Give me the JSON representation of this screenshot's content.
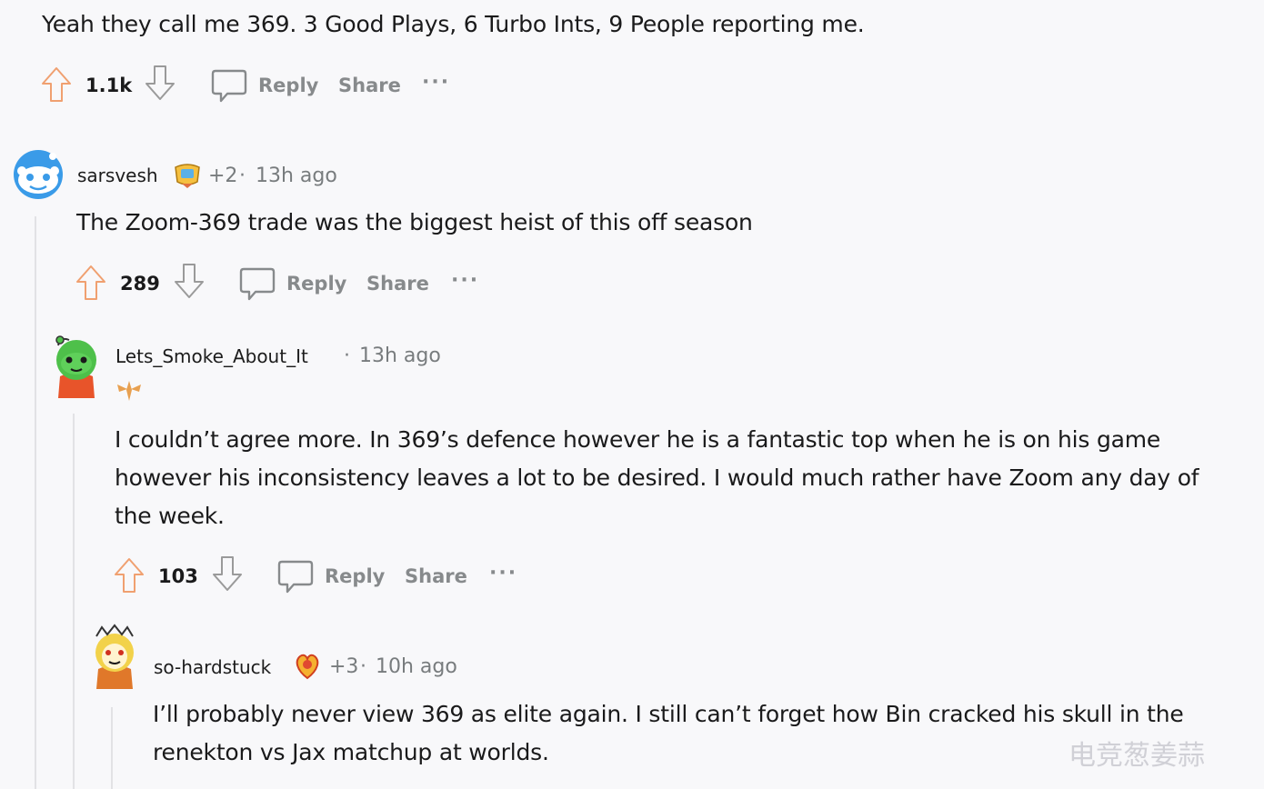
{
  "top_comment": {
    "text": "Yeah they call me 369. 3 Good Plays, 6 Turbo Ints, 9 People reporting me.",
    "votes": "1.1k",
    "reply_label": "Reply",
    "share_label": "Share",
    "more_label": "···"
  },
  "comment1": {
    "username": "sarsvesh",
    "award_count": "+2",
    "sep": "·",
    "time": "13h ago",
    "text": "The Zoom-369 trade was the biggest heist of this off season",
    "votes": "289",
    "reply_label": "Reply",
    "share_label": "Share",
    "more_label": "···"
  },
  "comment2": {
    "username": "Lets_Smoke_About_It",
    "sep": "·",
    "time": "13h ago",
    "text": "I couldn’t agree more. In 369’s defence however he is a fantastic top when he is on his game however his inconsistency leaves a lot to be desired. I would much rather have Zoom any day of the week.",
    "votes": "103",
    "reply_label": "Reply",
    "share_label": "Share",
    "more_label": "···"
  },
  "comment3": {
    "username": "so-hardstuck",
    "award_count": "+3",
    "sep": "·",
    "time": "10h ago",
    "text": "I’ll probably never view 369 as elite again. I still can’t forget how Bin cracked his skull in the renekton vs Jax matchup at worlds."
  },
  "watermark": "电竞葱姜蒜",
  "colors": {
    "upvote": "#f0a070",
    "downvote": "#9a9a9a",
    "action_gray": "#878a8c",
    "thread_line": "#e2e2e5"
  }
}
